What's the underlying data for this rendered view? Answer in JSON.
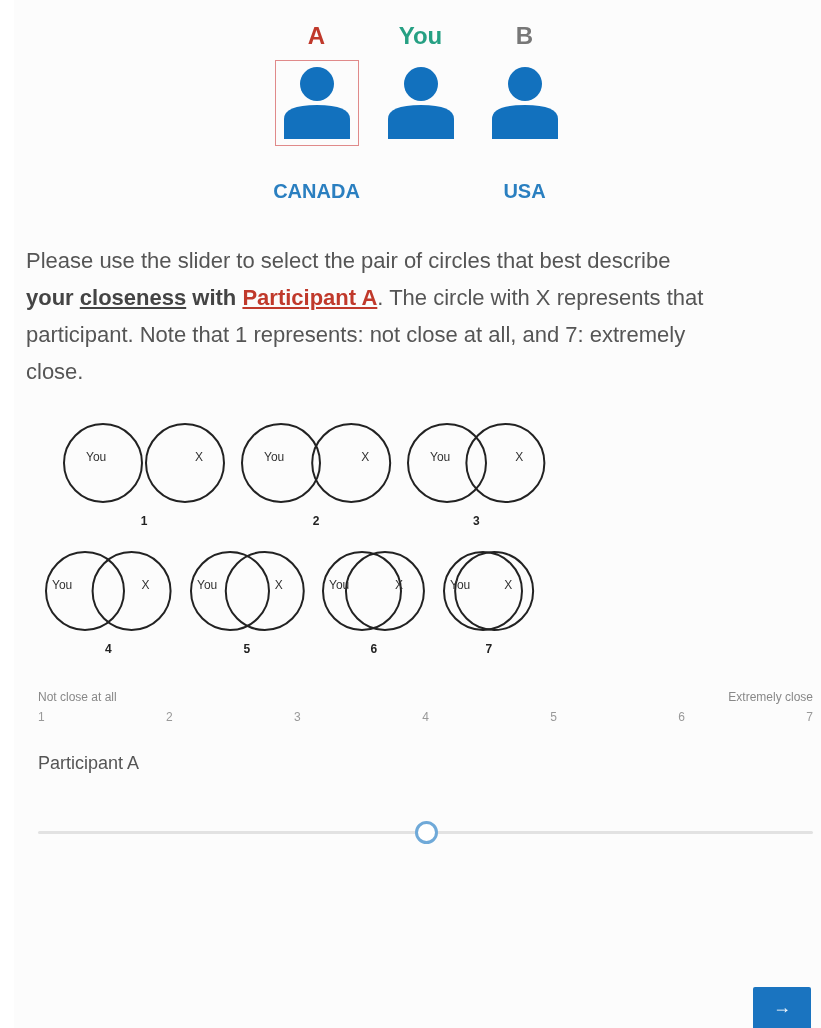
{
  "participants": [
    {
      "label": "A",
      "color": "#c0392b",
      "selected": true,
      "country": "CANADA"
    },
    {
      "label": "You",
      "color": "#26a083",
      "selected": false
    },
    {
      "label": "B",
      "color": "#777777",
      "selected": false,
      "country": "USA"
    }
  ],
  "instruction_parts": [
    "Please use the slider to select the pair of circles that best describe ",
    "your ",
    "closeness",
    " with ",
    "Participant A",
    ". The circle with X represents that participant. Note that 1 represents: not close at all, and 7: extremely close."
  ],
  "diagrams": [
    {
      "left": "You",
      "right": "X",
      "number": "1"
    },
    {
      "left": "You",
      "right": "X",
      "number": "2"
    },
    {
      "left": "You",
      "right": "X",
      "number": "3"
    },
    {
      "left": "You",
      "right": "X",
      "number": "4"
    },
    {
      "left": "You",
      "right": "X",
      "number": "5"
    },
    {
      "left": "You",
      "right": "X",
      "number": "6"
    },
    {
      "left": "You",
      "right": "X",
      "number": "7"
    }
  ],
  "scale": {
    "min_label": "Not close at all",
    "max_label": "Extremely close",
    "ticks": [
      "1",
      "2",
      "3",
      "4",
      "5",
      "6",
      "7"
    ]
  },
  "slider": {
    "label": "Participant A",
    "level": 0.5
  },
  "next_button": {
    "label": "→"
  }
}
